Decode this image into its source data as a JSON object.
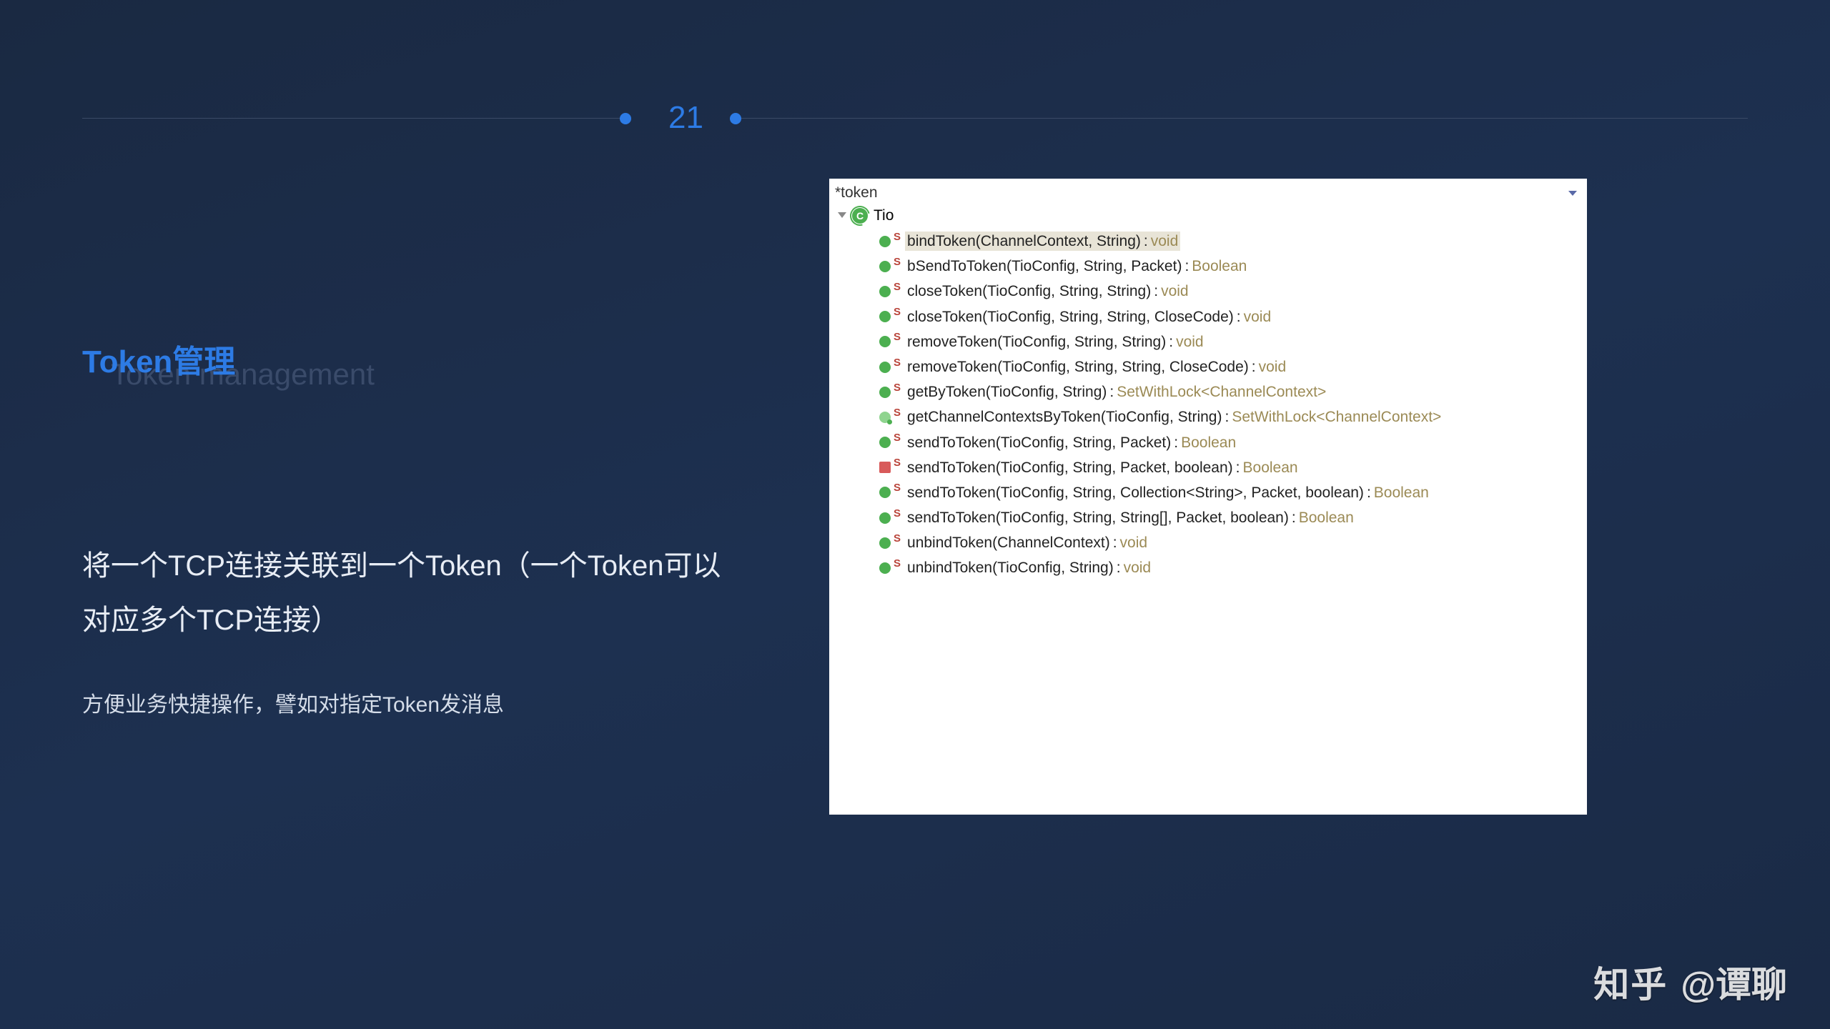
{
  "page_number": "21",
  "title_main": "Token管理",
  "title_shadow": "Token management",
  "body_line1": "将一个TCP连接关联到一个Token（一个Token可以对应多个TCP连接）",
  "body_line2": "方便业务快捷操作，譬如对指定Token发消息",
  "ide": {
    "search_value": "*token",
    "class_name": "Tio",
    "methods": [
      {
        "icon": "green",
        "selected": true,
        "sig": "bindToken(ChannelContext, String)",
        "ret": "void"
      },
      {
        "icon": "green",
        "selected": false,
        "sig": "bSendToToken(TioConfig, String, Packet)",
        "ret": "Boolean"
      },
      {
        "icon": "green",
        "selected": false,
        "sig": "closeToken(TioConfig, String, String)",
        "ret": "void"
      },
      {
        "icon": "green",
        "selected": false,
        "sig": "closeToken(TioConfig, String, String, CloseCode)",
        "ret": "void"
      },
      {
        "icon": "green",
        "selected": false,
        "sig": "removeToken(TioConfig, String, String)",
        "ret": "void"
      },
      {
        "icon": "green",
        "selected": false,
        "sig": "removeToken(TioConfig, String, String, CloseCode)",
        "ret": "void"
      },
      {
        "icon": "green",
        "selected": false,
        "sig": "getByToken(TioConfig, String)",
        "ret": "SetWithLock<ChannelContext>"
      },
      {
        "icon": "light",
        "selected": false,
        "sig": "getChannelContextsByToken(TioConfig, String)",
        "ret": "SetWithLock<ChannelContext>"
      },
      {
        "icon": "green",
        "selected": false,
        "sig": "sendToToken(TioConfig, String, Packet)",
        "ret": "Boolean"
      },
      {
        "icon": "deprecated",
        "selected": false,
        "sig": "sendToToken(TioConfig, String, Packet, boolean)",
        "ret": "Boolean"
      },
      {
        "icon": "green",
        "selected": false,
        "sig": "sendToToken(TioConfig, String, Collection<String>, Packet, boolean)",
        "ret": "Boolean"
      },
      {
        "icon": "green",
        "selected": false,
        "sig": "sendToToken(TioConfig, String, String[], Packet, boolean)",
        "ret": "Boolean"
      },
      {
        "icon": "green",
        "selected": false,
        "sig": "unbindToken(ChannelContext)",
        "ret": "void"
      },
      {
        "icon": "green",
        "selected": false,
        "sig": "unbindToken(TioConfig, String)",
        "ret": "void"
      }
    ]
  },
  "watermark": {
    "logo": "知乎",
    "author": "@谭聊"
  }
}
